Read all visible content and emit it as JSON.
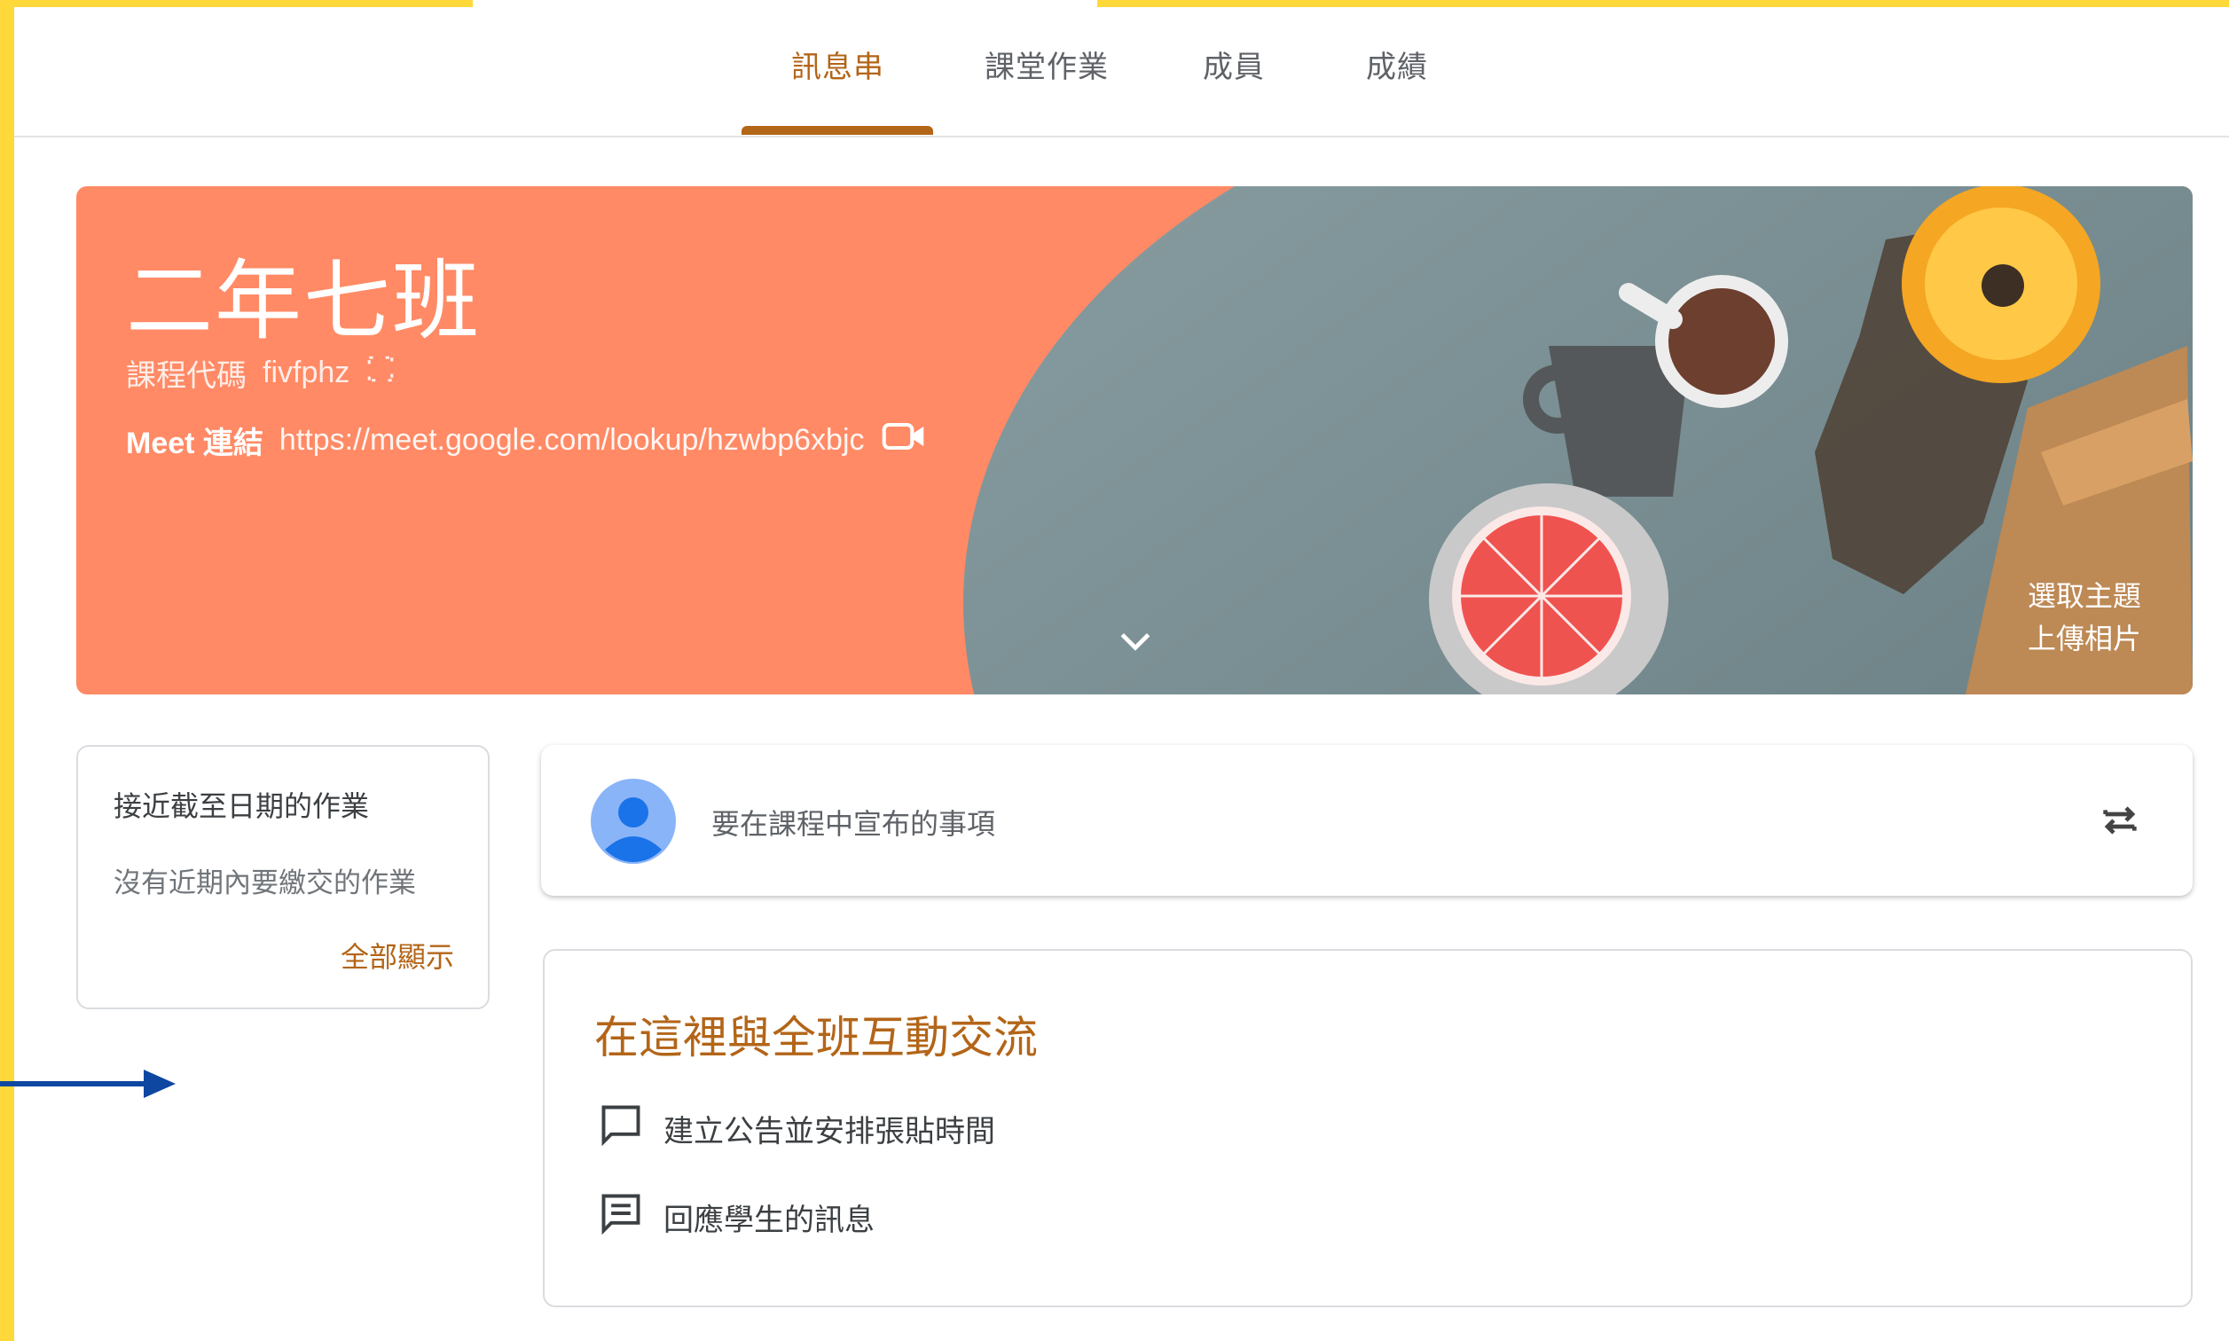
{
  "tabs": [
    {
      "label": "訊息串",
      "active": true
    },
    {
      "label": "課堂作業",
      "active": false
    },
    {
      "label": "成員",
      "active": false
    },
    {
      "label": "成績",
      "active": false
    }
  ],
  "banner": {
    "title": "二年七班",
    "code_label": "課程代碼",
    "code_value": "fivfphz",
    "meet_label": "Meet 連結",
    "meet_url": "https://meet.google.com/lookup/hzwbp6xbjc",
    "select_theme": "選取主題",
    "upload_photo": "上傳相片",
    "color": "#FF8A65"
  },
  "upcoming": {
    "title": "接近截至日期的作業",
    "empty_text": "沒有近期內要繳交的作業",
    "view_all": "全部顯示"
  },
  "announce": {
    "placeholder": "要在課程中宣布的事項"
  },
  "interact": {
    "heading": "在這裡與全班互動交流",
    "items": [
      {
        "label": "建立公告並安排張貼時間",
        "icon": "announcement-icon"
      },
      {
        "label": "回應學生的訊息",
        "icon": "message-icon"
      }
    ]
  },
  "colors": {
    "accent": "#b36518",
    "frame": "#FFD83A",
    "arrow": "#0D47A1"
  }
}
